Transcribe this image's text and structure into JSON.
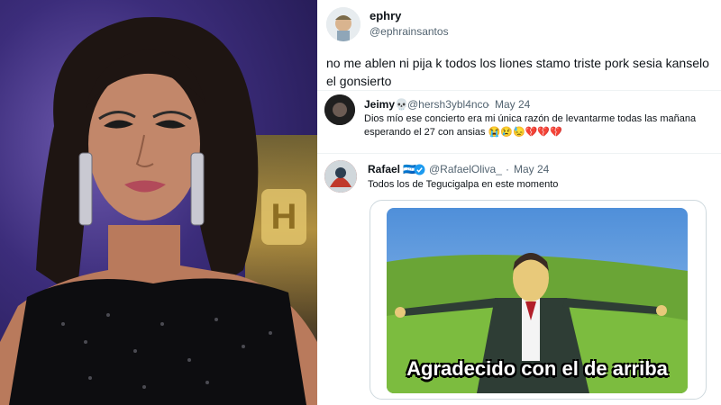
{
  "main_tweet": {
    "display_name": "ephry",
    "handle": "@ephrainsantos",
    "text": "no me ablen ni pija k todos los liones stamo triste pork sesia kanselo el gonsierto"
  },
  "reply_1": {
    "display_name": "Jeimy💀",
    "handle": "@hersh3ybl4nco",
    "separator": "·",
    "date": "May 24",
    "text": "Dios mío ese concierto era mi única razón de levantarme todas las mañana esperando el 27 con ansias 😭😢😓💔💔💔"
  },
  "reply_2": {
    "display_name": "Rafael 🇭🇳",
    "verified_icon": "verified-badge-icon",
    "handle": "@RafaelOliva_",
    "separator": "·",
    "date": "May 24",
    "text": "Todos los de Tegucigalpa en este momento",
    "meme_caption": "Agradecido con el de arriba"
  },
  "colors": {
    "verified": "#1d9bf0",
    "text": "#0f1419",
    "secondary": "#536471"
  }
}
